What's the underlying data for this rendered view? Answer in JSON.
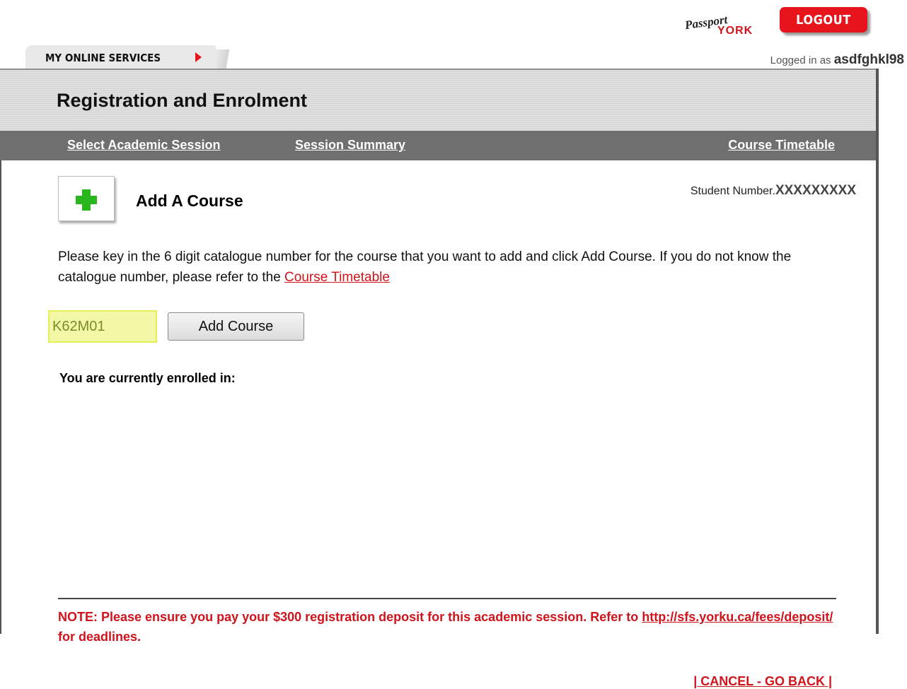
{
  "header": {
    "logo": {
      "line1": "Passport",
      "line2": "YORK"
    },
    "logout_label": "LOGOUT",
    "online_services_label": "MY ONLINE SERVICES",
    "logged_in_prefix": "Logged in as",
    "username": "asdfghkl98"
  },
  "page": {
    "title": "Registration and Enrolment"
  },
  "subnav": {
    "select_session": "Select Academic Session",
    "session_summary": "Session Summary",
    "course_timetable": "Course Timetable"
  },
  "content": {
    "section_title": "Add A Course",
    "student_number_label": "Student Number.",
    "student_number_value": "XXXXXXXXX",
    "instructions_text": "Please key in the 6 digit catalogue number for the course that you want to add and click Add Course. If you do not know the catalogue number, please refer to the",
    "instructions_link": "Course Timetable",
    "catalogue_input_value": "K62M01",
    "add_course_label": "Add Course",
    "enrolled_label": "You are currently enrolled in:"
  },
  "note": {
    "text_before": "NOTE: Please ensure you pay your $300 registration deposit for this academic session. Refer to",
    "link": "http://sfs.yorku.ca/fees/deposit/",
    "text_after": "for deadlines."
  },
  "footer": {
    "cancel_label": "| CANCEL - GO BACK |"
  },
  "colors": {
    "accent_red": "#e8141c",
    "input_highlight": "#f3f8a6",
    "nav_gray": "#6f6f6f",
    "add_green": "#2ab71d"
  }
}
